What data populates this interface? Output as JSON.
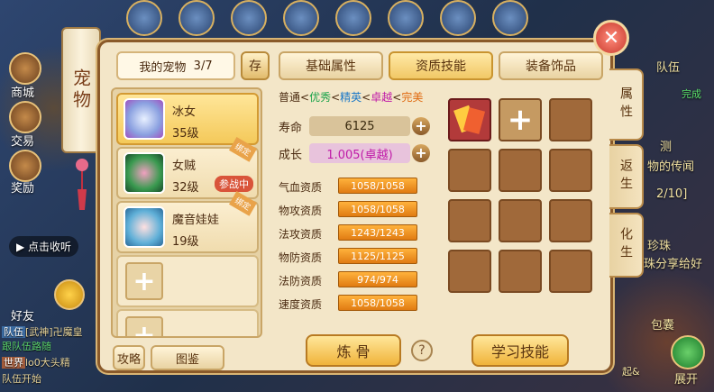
{
  "left_menu": {
    "mall": "商城",
    "trade": "交易",
    "reward": "奖励",
    "click_collect": "点击收听",
    "friends": "好友"
  },
  "chat": [
    {
      "channel": "队伍",
      "text": "[武神]卍魔皇"
    },
    {
      "channel": "",
      "text": "跟队伍路随"
    },
    {
      "channel": "世界",
      "text": "lo0大头精"
    },
    {
      "channel": "",
      "text": "队伍开始"
    }
  ],
  "right_side": {
    "team": "队伍",
    "complete": "完成",
    "news1": "测",
    "news2": "物的传闻",
    "progress": "2/10]",
    "bead": "珍珠",
    "share": "珠分享给好",
    "bag": "包囊",
    "expand": "展开",
    "rank": "起&"
  },
  "scroll_title": "宠物",
  "header": {
    "pet_count_label": "我的宠物",
    "pet_count": "3/7",
    "save": "存",
    "tabs": [
      "基础属性",
      "资质技能",
      "装备饰品"
    ],
    "active_tab": 1
  },
  "pets": [
    {
      "name": "冰女",
      "level": "35级",
      "selected": true,
      "battle": "",
      "bind": ""
    },
    {
      "name": "女贼",
      "level": "32级",
      "selected": false,
      "battle": "参战中",
      "bind": "绑定"
    },
    {
      "name": "魔音娃娃",
      "level": "19级",
      "selected": false,
      "battle": "",
      "bind": "绑定"
    }
  ],
  "bottom_left": {
    "guide": "攻略",
    "album": "图鉴"
  },
  "quality": {
    "normal": "普通",
    "excellent": "优秀",
    "elite": "精英",
    "superb": "卓越",
    "perfect": "完美"
  },
  "stats": {
    "life_label": "寿命",
    "life": "6125",
    "growth_label": "成长",
    "growth": "1.005(卓越)"
  },
  "aptitudes": [
    {
      "label": "气血资质",
      "value": "1058/1058"
    },
    {
      "label": "物攻资质",
      "value": "1058/1058"
    },
    {
      "label": "法攻资质",
      "value": "1243/1243"
    },
    {
      "label": "物防资质",
      "value": "1125/1125"
    },
    {
      "label": "法防资质",
      "value": "974/974"
    },
    {
      "label": "速度资质",
      "value": "1058/1058"
    }
  ],
  "buttons": {
    "refine": "炼 骨",
    "learn": "学习技能",
    "help": "?"
  },
  "side_tabs": [
    "属性",
    "返生",
    "化生"
  ],
  "colors": {
    "excellent": "#1aa34a",
    "elite": "#1a78c8",
    "superb": "#c01aa8",
    "perfect": "#e06a10"
  }
}
